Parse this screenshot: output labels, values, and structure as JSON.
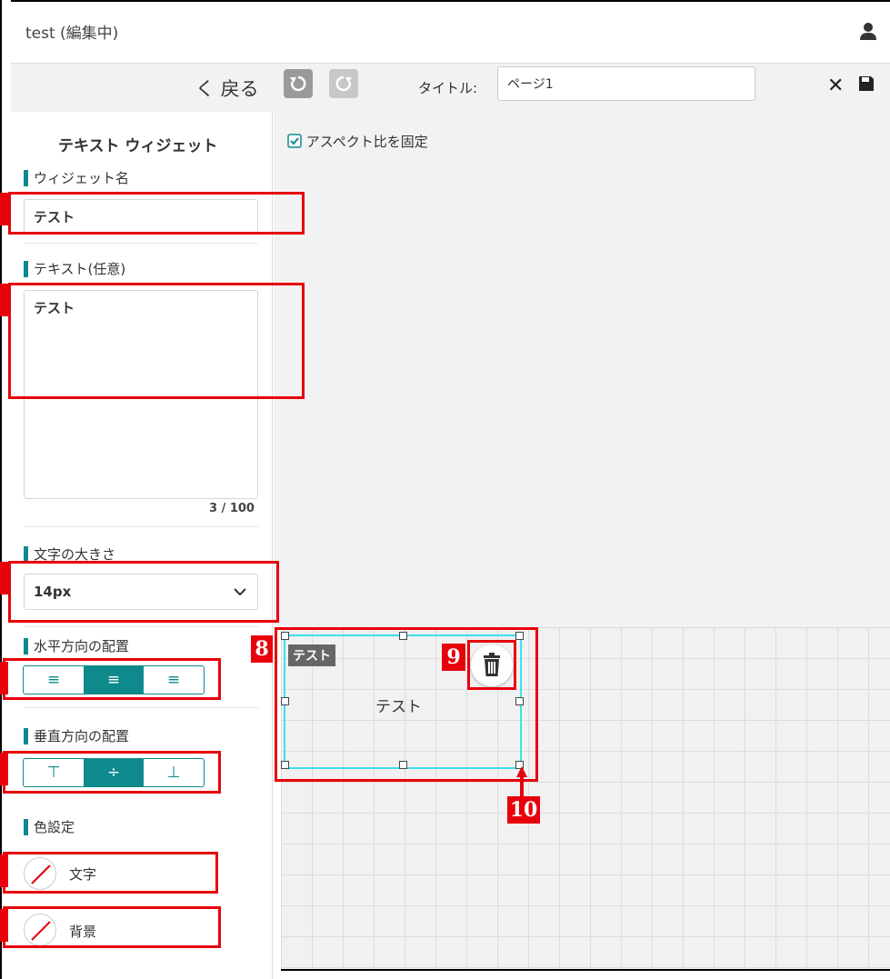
{
  "header": {
    "title": "test (編集中)",
    "user_icon": "user-icon"
  },
  "toolbar": {
    "back_label": "く 戻る",
    "undo_icon": "undo-icon",
    "redo_icon": "redo-icon",
    "title_label": "タイトル:",
    "title_value": "ページ1",
    "close_label": "✕",
    "save_icon": "save-icon"
  },
  "sidebar": {
    "heading": "テキスト ウィジェット",
    "widget_name": {
      "label": "ウィジェット名",
      "value": "テスト"
    },
    "text": {
      "label": "テキスト(任意)",
      "value": "テスト",
      "counter": "3 / 100"
    },
    "font_size": {
      "label": "文字の大きさ",
      "value": "14px"
    },
    "horizontal_align": {
      "label": "水平方向の配置",
      "options": [
        "≡",
        "≡",
        "≡"
      ],
      "selected": 1
    },
    "vertical_align": {
      "label": "垂直方向の配置",
      "options": [
        "⊤",
        "÷",
        "⊥"
      ],
      "selected": 1
    },
    "color": {
      "label": "色設定",
      "text_label": "文字",
      "bg_label": "背景"
    }
  },
  "canvas": {
    "aspect_label": "アスペクト比を固定",
    "aspect_checked": true,
    "widget_tag": "テスト",
    "widget_text": "テスト",
    "trash_icon": "trash-icon"
  },
  "markers": {
    "m8": "8",
    "m9": "9",
    "m10": "10"
  },
  "colors": {
    "accent": "#0f8a8c",
    "highlight": "#e8000c",
    "selection": "#3fe0ea"
  }
}
